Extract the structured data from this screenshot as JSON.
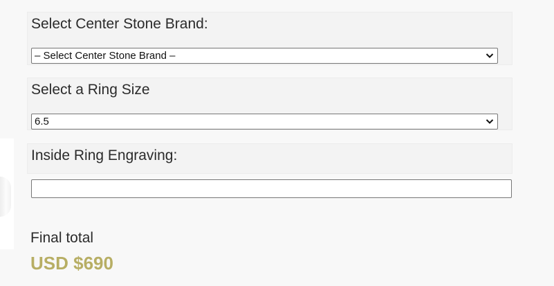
{
  "center_stone_brand": {
    "label": "Select Center Stone Brand:",
    "selected_value": "– Select Center Stone Brand –"
  },
  "ring_size": {
    "label": "Select a Ring Size",
    "selected_value": "6.5"
  },
  "engraving": {
    "label": "Inside Ring Engraving:",
    "value": "",
    "placeholder": ""
  },
  "total": {
    "label": "Final total",
    "price": "USD $690"
  },
  "colors": {
    "price_accent": "#b7ae64",
    "page_background": "#f8f8f8",
    "section_background": "#f3f3f3"
  },
  "icons": [
    "chevron-down-icon",
    "chevron-down-icon"
  ]
}
